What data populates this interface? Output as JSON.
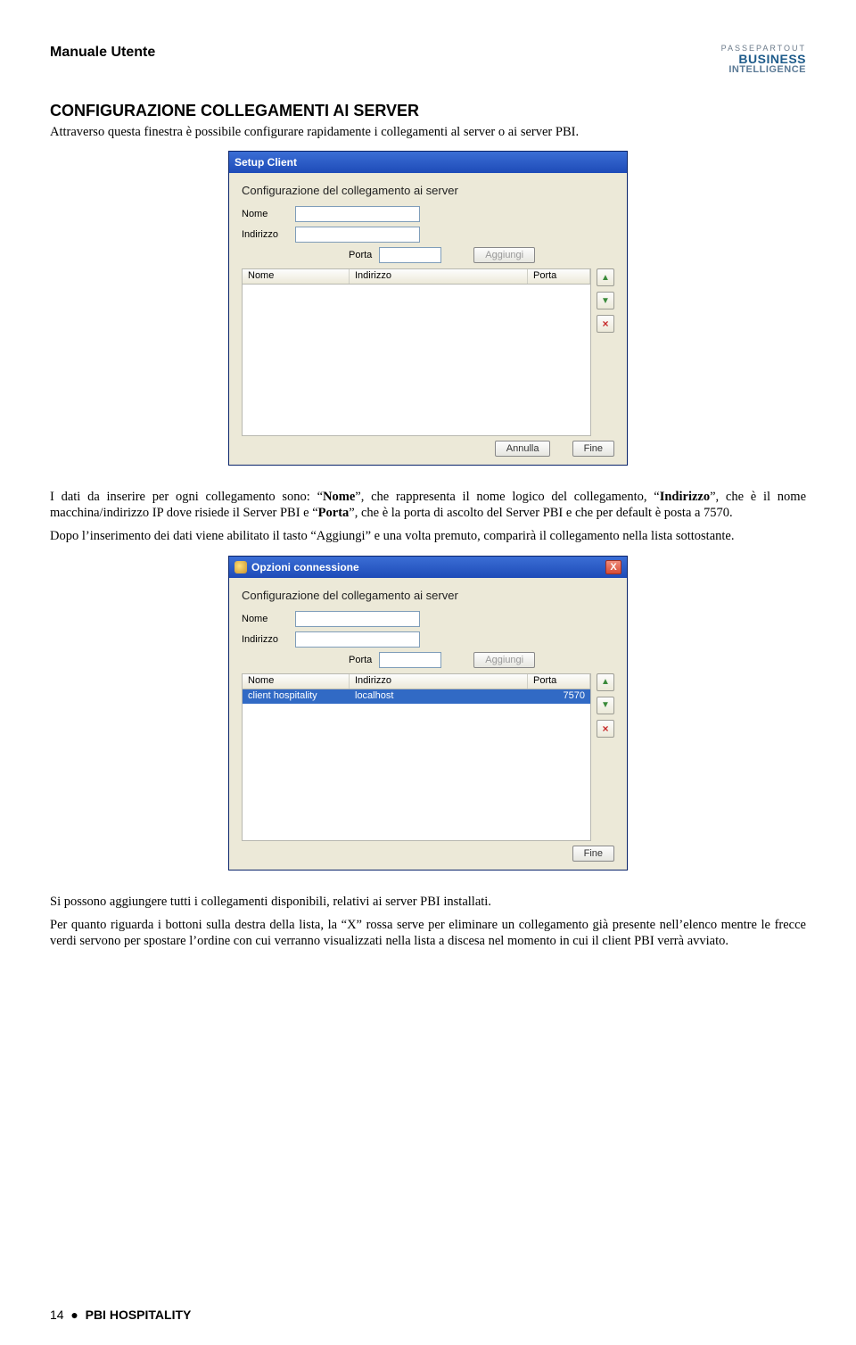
{
  "header": {
    "doc_title": "Manuale Utente",
    "logo_line1": "PASSEPARTOUT",
    "logo_line2": "BUSINESS",
    "logo_line3": "INTELLIGENCE"
  },
  "section_title": "CONFIGURAZIONE COLLEGAMENTI AI SERVER",
  "intro_text": "Attraverso questa finestra è possibile configurare rapidamente i collegamenti al server o ai server PBI.",
  "para2_pre": "I dati da inserire per ogni collegamento sono: “",
  "para2_b1": "Nome",
  "para2_m1": "”, che rappresenta il nome logico del collegamento, “",
  "para2_b2": "Indirizzo",
  "para2_m2": "”, che è il nome macchina/indirizzo IP dove risiede il Server PBI e “",
  "para2_b3": "Porta",
  "para2_m3": "”, che è la porta di ascolto del Server PBI e che per default è posta a 7570.",
  "para3": "Dopo l’inserimento dei dati viene abilitato il tasto “Aggiungi” e una volta premuto, comparirà il collegamento nella lista sottostante.",
  "para4": "Si possono aggiungere tutti i collegamenti disponibili, relativi ai server PBI installati.",
  "para5": "Per quanto riguarda i bottoni sulla destra della lista, la “X” rossa serve per eliminare un collegamento già presente nell’elenco mentre le frecce verdi servono per spostare l’ordine con cui verranno visualizzati nella lista a discesa nel momento in cui il client PBI verrà avviato.",
  "dlg1": {
    "title": "Setup Client",
    "group_title": "Configurazione del collegamento ai server",
    "lbl_nome": "Nome",
    "lbl_indirizzo": "Indirizzo",
    "lbl_porta": "Porta",
    "btn_aggiungi": "Aggiungi",
    "col_nome": "Nome",
    "col_indirizzo": "Indirizzo",
    "col_porta": "Porta",
    "btn_annulla": "Annulla",
    "btn_fine": "Fine"
  },
  "dlg2": {
    "title": "Opzioni connessione",
    "group_title": "Configurazione del collegamento ai server",
    "lbl_nome": "Nome",
    "lbl_indirizzo": "Indirizzo",
    "lbl_porta": "Porta",
    "btn_aggiungi": "Aggiungi",
    "col_nome": "Nome",
    "col_indirizzo": "Indirizzo",
    "col_porta": "Porta",
    "row_nome": "client hospitality",
    "row_indirizzo": "localhost",
    "row_porta": "7570",
    "btn_fine": "Fine"
  },
  "footer": {
    "page_num": "14",
    "bullet": "●",
    "product": "PBI HOSPITALITY"
  }
}
